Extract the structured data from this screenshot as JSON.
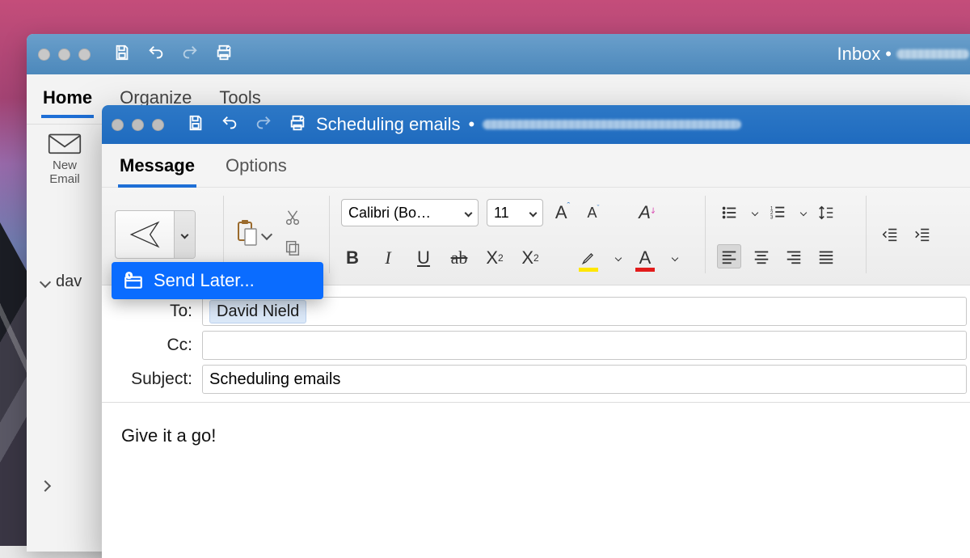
{
  "back_window": {
    "toolbar_title": "Inbox",
    "tabs": {
      "home": "Home",
      "organize": "Organize",
      "tools": "Tools"
    },
    "new_email": {
      "line1": "New",
      "line2": "Email"
    },
    "account_short": "dav"
  },
  "compose": {
    "title": "Scheduling emails",
    "tabs": {
      "message": "Message",
      "options": "Options"
    },
    "send_menu": {
      "send_later": "Send Later..."
    },
    "font": {
      "name": "Calibri (Bo…",
      "size": "11"
    },
    "headers": {
      "to_label": "To:",
      "cc_label": "Cc:",
      "subject_label": "Subject:",
      "to_value": "David Nield",
      "cc_value": "",
      "subject_value": "Scheduling emails"
    },
    "body": "Give it a go!"
  }
}
